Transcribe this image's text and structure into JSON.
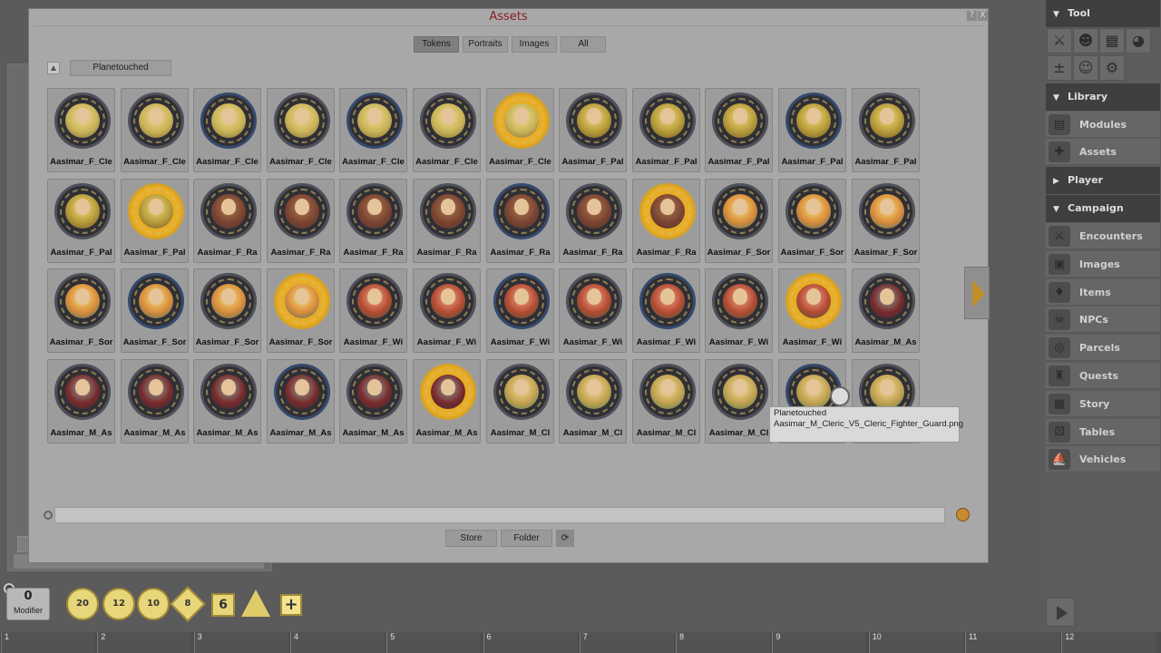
{
  "window": {
    "title": "Assets",
    "help": "?",
    "close": "X",
    "tabs": [
      {
        "label": "Tokens",
        "active": true
      },
      {
        "label": "Portraits",
        "active": false
      },
      {
        "label": "Images",
        "active": false
      },
      {
        "label": "All",
        "active": false
      }
    ],
    "folder": "Planetouched",
    "tokens": [
      {
        "label": "Aasimar_F_Cle",
        "style": "cleric",
        "frame": "dark"
      },
      {
        "label": "Aasimar_F_Cle",
        "style": "cleric",
        "frame": "dark"
      },
      {
        "label": "Aasimar_F_Cle",
        "style": "cleric",
        "frame": "blue"
      },
      {
        "label": "Aasimar_F_Cle",
        "style": "cleric",
        "frame": "dark"
      },
      {
        "label": "Aasimar_F_Cle",
        "style": "cleric",
        "frame": "blue"
      },
      {
        "label": "Aasimar_F_Cle",
        "style": "cleric",
        "frame": "dark"
      },
      {
        "label": "Aasimar_F_Cle",
        "style": "cleric",
        "frame": "gold"
      },
      {
        "label": "Aasimar_F_Pal",
        "style": "pal",
        "frame": "dark"
      },
      {
        "label": "Aasimar_F_Pal",
        "style": "pal",
        "frame": "dark"
      },
      {
        "label": "Aasimar_F_Pal",
        "style": "pal",
        "frame": "dark"
      },
      {
        "label": "Aasimar_F_Pal",
        "style": "pal",
        "frame": "blue"
      },
      {
        "label": "Aasimar_F_Pal",
        "style": "pal",
        "frame": "dark"
      },
      {
        "label": "Aasimar_F_Pal",
        "style": "pal",
        "frame": "dark"
      },
      {
        "label": "Aasimar_F_Pal",
        "style": "pal",
        "frame": "gold"
      },
      {
        "label": "Aasimar_F_Ra",
        "style": "ra",
        "frame": "dark"
      },
      {
        "label": "Aasimar_F_Ra",
        "style": "ra",
        "frame": "dark"
      },
      {
        "label": "Aasimar_F_Ra",
        "style": "ra",
        "frame": "dark"
      },
      {
        "label": "Aasimar_F_Ra",
        "style": "ra",
        "frame": "dark"
      },
      {
        "label": "Aasimar_F_Ra",
        "style": "ra",
        "frame": "blue"
      },
      {
        "label": "Aasimar_F_Ra",
        "style": "ra",
        "frame": "dark"
      },
      {
        "label": "Aasimar_F_Ra",
        "style": "ra",
        "frame": "gold"
      },
      {
        "label": "Aasimar_F_Sor",
        "style": "sor",
        "frame": "dark"
      },
      {
        "label": "Aasimar_F_Sor",
        "style": "sor",
        "frame": "dark"
      },
      {
        "label": "Aasimar_F_Sor",
        "style": "sor",
        "frame": "dark"
      },
      {
        "label": "Aasimar_F_Sor",
        "style": "sor",
        "frame": "dark"
      },
      {
        "label": "Aasimar_F_Sor",
        "style": "sor",
        "frame": "blue"
      },
      {
        "label": "Aasimar_F_Sor",
        "style": "sor",
        "frame": "dark"
      },
      {
        "label": "Aasimar_F_Sor",
        "style": "sor",
        "frame": "gold"
      },
      {
        "label": "Aasimar_F_Wi",
        "style": "wi",
        "frame": "dark"
      },
      {
        "label": "Aasimar_F_Wi",
        "style": "wi",
        "frame": "dark"
      },
      {
        "label": "Aasimar_F_Wi",
        "style": "wi",
        "frame": "blue"
      },
      {
        "label": "Aasimar_F_Wi",
        "style": "wi",
        "frame": "dark"
      },
      {
        "label": "Aasimar_F_Wi",
        "style": "wi",
        "frame": "blue"
      },
      {
        "label": "Aasimar_F_Wi",
        "style": "wi",
        "frame": "dark"
      },
      {
        "label": "Aasimar_F_Wi",
        "style": "wi",
        "frame": "gold"
      },
      {
        "label": "Aasimar_M_As",
        "style": "as",
        "frame": "dark"
      },
      {
        "label": "Aasimar_M_As",
        "style": "as",
        "frame": "dark"
      },
      {
        "label": "Aasimar_M_As",
        "style": "as",
        "frame": "dark"
      },
      {
        "label": "Aasimar_M_As",
        "style": "as",
        "frame": "dark"
      },
      {
        "label": "Aasimar_M_As",
        "style": "as",
        "frame": "blue"
      },
      {
        "label": "Aasimar_M_As",
        "style": "as",
        "frame": "dark"
      },
      {
        "label": "Aasimar_M_As",
        "style": "as",
        "frame": "gold"
      },
      {
        "label": "Aasimar_M_Cl",
        "style": "cl",
        "frame": "dark"
      },
      {
        "label": "Aasimar_M_Cl",
        "style": "cl",
        "frame": "dark"
      },
      {
        "label": "Aasimar_M_Cl",
        "style": "cl",
        "frame": "dark"
      },
      {
        "label": "Aasimar_M_Cl",
        "style": "cl",
        "frame": "dark"
      },
      {
        "label": "Aasimar_M_Cl",
        "style": "cl",
        "frame": "blue"
      },
      {
        "label": "Aasimar_M_Cl",
        "style": "cl",
        "frame": "dark"
      }
    ],
    "tooltip": {
      "line1": "Planetouched",
      "line2": "Aasimar_M_Cleric_V5_Cleric_Fighter_Guard.png"
    },
    "search": {
      "value": "",
      "placeholder": ""
    },
    "buttons": {
      "store": "Store",
      "folder": "Folder"
    }
  },
  "sidebar": {
    "tool_header": "Tool",
    "library_header": "Library",
    "library_items": [
      {
        "label": "Modules",
        "icon": "modules-icon",
        "glyph": "▤"
      },
      {
        "label": "Assets",
        "icon": "assets-icon",
        "glyph": "✚"
      }
    ],
    "player_header": "Player",
    "campaign_header": "Campaign",
    "campaign_items": [
      {
        "label": "Encounters",
        "icon": "encounters-icon",
        "glyph": "⚔"
      },
      {
        "label": "Images",
        "icon": "images-icon",
        "glyph": "▣"
      },
      {
        "label": "Items",
        "icon": "items-icon",
        "glyph": "♦"
      },
      {
        "label": "NPCs",
        "icon": "npcs-icon",
        "glyph": "☠"
      },
      {
        "label": "Parcels",
        "icon": "parcels-icon",
        "glyph": "◎"
      },
      {
        "label": "Quests",
        "icon": "quests-icon",
        "glyph": "♜"
      },
      {
        "label": "Story",
        "icon": "story-icon",
        "glyph": "▦"
      },
      {
        "label": "Tables",
        "icon": "tables-icon",
        "glyph": "⚄"
      },
      {
        "label": "Vehicles",
        "icon": "vehicles-icon",
        "glyph": "⛵"
      }
    ]
  },
  "dice": {
    "modifier_value": "0",
    "modifier_label": "Modifier",
    "d20": "20",
    "d12": "12",
    "d10": "10",
    "d8": "8",
    "d6": "6",
    "plus": "+"
  },
  "ruler": [
    "1",
    "2",
    "3",
    "4",
    "5",
    "6",
    "7",
    "8",
    "9",
    "10",
    "11",
    "12"
  ]
}
